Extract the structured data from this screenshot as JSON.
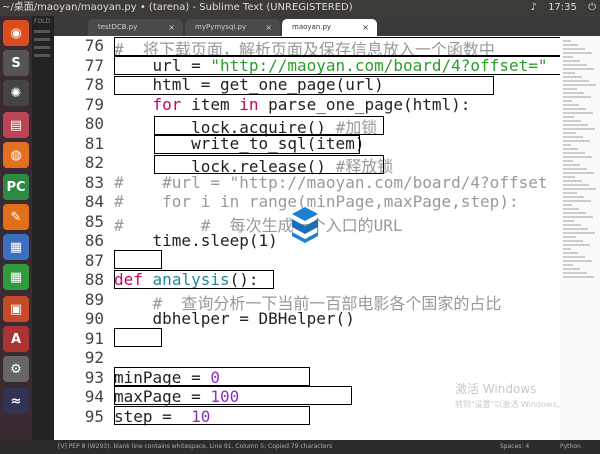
{
  "window": {
    "title": "~/桌面/maoyan/maoyan.py • (tarena) - Sublime Text (UNREGISTERED)",
    "time": "17:35"
  },
  "sidebar": {
    "folders_label": "FOLD"
  },
  "tabs": [
    {
      "label": "testDCB.py"
    },
    {
      "label": "myPymysql.py"
    },
    {
      "label": "maoyan.py"
    }
  ],
  "lines": [
    {
      "n": "76",
      "parts": [
        {
          "t": "#  将下载页面，解析页面及保存信息放入一个函数中",
          "c": "cm"
        }
      ]
    },
    {
      "n": "77",
      "parts": [
        {
          "t": "    url = ",
          "c": ""
        },
        {
          "t": "\"http://maoyan.com/board/4?offset=\"",
          "c": "str"
        }
      ]
    },
    {
      "n": "78",
      "parts": [
        {
          "t": "    html = get_one_page(url)",
          "c": ""
        }
      ]
    },
    {
      "n": "79",
      "parts": [
        {
          "t": "    ",
          "c": ""
        },
        {
          "t": "for",
          "c": "kw"
        },
        {
          "t": " item ",
          "c": ""
        },
        {
          "t": "in",
          "c": "kw"
        },
        {
          "t": " parse_one_page(html):",
          "c": ""
        }
      ]
    },
    {
      "n": "80",
      "parts": [
        {
          "t": "        lock.acquire() ",
          "c": ""
        },
        {
          "t": "#加锁",
          "c": "cm"
        }
      ]
    },
    {
      "n": "81",
      "parts": [
        {
          "t": "        write_to_sql(item)",
          "c": ""
        }
      ]
    },
    {
      "n": "82",
      "parts": [
        {
          "t": "        lock.release() ",
          "c": ""
        },
        {
          "t": "#释放锁",
          "c": "cm"
        }
      ]
    },
    {
      "n": "83",
      "parts": [
        {
          "t": "#    #url = \"http://maoyan.com/board/4?offset",
          "c": "cm"
        }
      ]
    },
    {
      "n": "84",
      "parts": [
        {
          "t": "#    for i in range(minPage,maxPage,step):",
          "c": "cm"
        }
      ]
    },
    {
      "n": "85",
      "parts": [
        {
          "t": "#        #  每次生成一个入口的URL",
          "c": "cm"
        }
      ]
    },
    {
      "n": "86",
      "parts": [
        {
          "t": "    time.sleep(1)",
          "c": ""
        }
      ]
    },
    {
      "n": "87",
      "parts": []
    },
    {
      "n": "88",
      "parts": [
        {
          "t": "def",
          "c": "kw"
        },
        {
          "t": " ",
          "c": ""
        },
        {
          "t": "analysis",
          "c": "fn"
        },
        {
          "t": "():",
          "c": ""
        }
      ]
    },
    {
      "n": "89",
      "parts": [
        {
          "t": "    #  查询分析一下当前一百部电影各个国家的占比",
          "c": "cm"
        }
      ]
    },
    {
      "n": "90",
      "parts": [
        {
          "t": "    dbhelper = DBHelper()",
          "c": ""
        }
      ]
    },
    {
      "n": "91",
      "parts": []
    },
    {
      "n": "92",
      "parts": []
    },
    {
      "n": "93",
      "parts": [
        {
          "t": "minPage = ",
          "c": ""
        },
        {
          "t": "0",
          "c": "num"
        }
      ]
    },
    {
      "n": "94",
      "parts": [
        {
          "t": "maxPage = ",
          "c": ""
        },
        {
          "t": "100",
          "c": "num"
        }
      ]
    },
    {
      "n": "95",
      "parts": [
        {
          "t": "step =  ",
          "c": ""
        },
        {
          "t": "10",
          "c": "num"
        }
      ]
    }
  ],
  "watermark": {
    "title": "激活 Windows",
    "subtitle": "转到\"设置\"以激活 Windows。"
  },
  "statusbar": {
    "left": "[V] PEP 8 (W293): blank line contains whitespace, Line 91, Column 5; Copied 79 characters",
    "spaces": "Spaces: 4",
    "syntax": "Python"
  }
}
